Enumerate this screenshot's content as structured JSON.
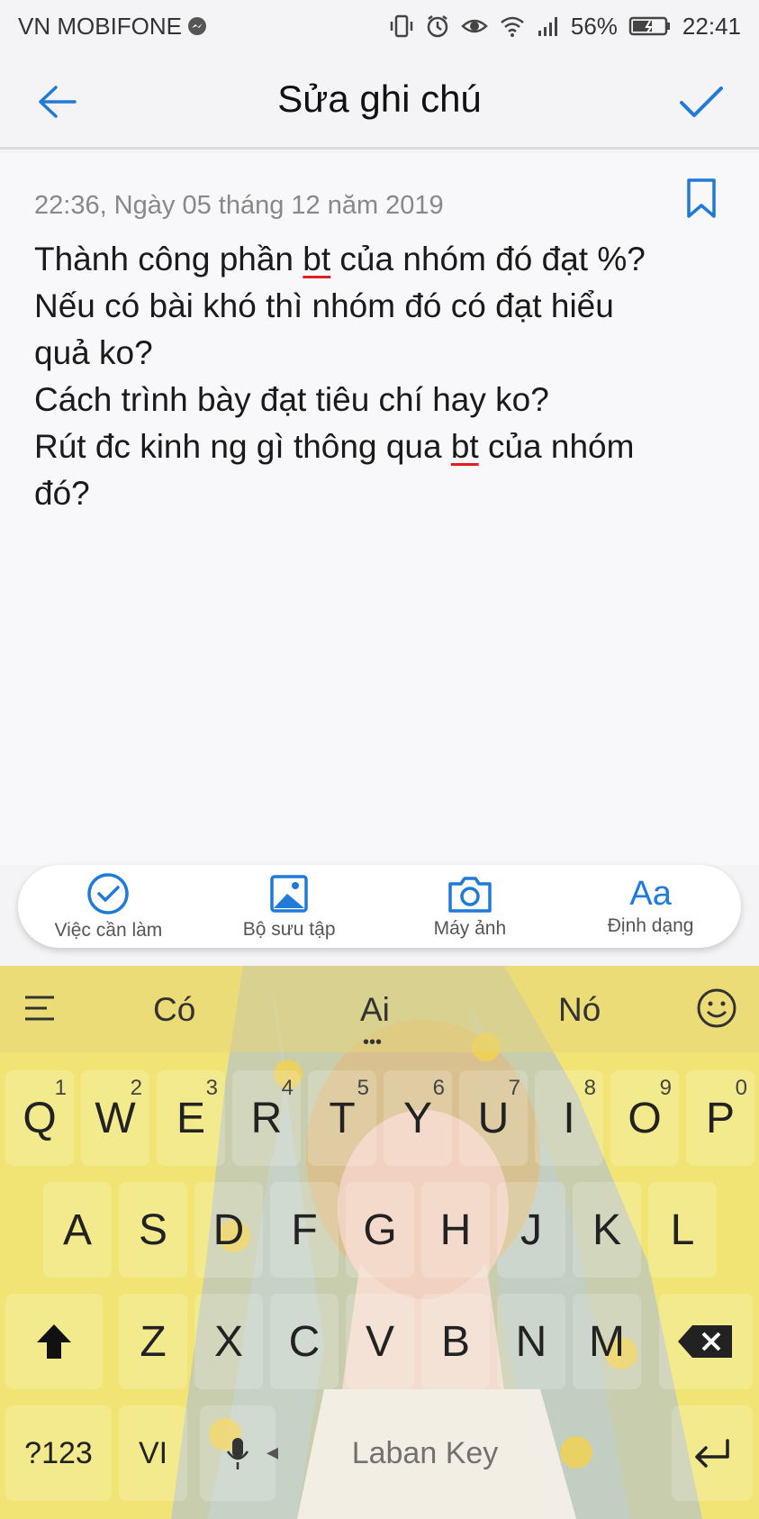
{
  "status_bar": {
    "carrier": "VN MOBIFONE",
    "battery": "56%",
    "time": "22:41",
    "icons": [
      "messenger-icon",
      "vibrate-icon",
      "alarm-icon",
      "eye-icon",
      "wifi-icon",
      "signal-icon",
      "battery-icon"
    ]
  },
  "header": {
    "title": "Sửa ghi chú",
    "accent": "#1f7ad8"
  },
  "note": {
    "timestamp": "22:36, Ngày 05 tháng 12 năm 2019",
    "lines": [
      {
        "pre": "Thành công phần ",
        "mark": "bt",
        "post": " của nhóm đó đạt %?"
      },
      {
        "pre": "Nếu có bài khó thì nhóm đó có đạt hiểu",
        "mark": "",
        "post": ""
      },
      {
        "pre": "quả ko?",
        "mark": "",
        "post": ""
      },
      {
        "pre": "Cách trình bày đạt tiêu chí hay ko?",
        "mark": "",
        "post": ""
      },
      {
        "pre": "Rút đc kinh ng gì thông qua ",
        "mark": "bt",
        "post": " của nhóm"
      },
      {
        "pre": "đó?",
        "mark": "",
        "post": ""
      }
    ]
  },
  "toolbar": {
    "items": [
      {
        "label": "Việc cần làm",
        "icon": "checkmark-circle-icon"
      },
      {
        "label": "Bộ sưu tập",
        "icon": "gallery-icon"
      },
      {
        "label": "Máy ảnh",
        "icon": "camera-icon"
      },
      {
        "label": "Định dạng",
        "icon": "text-format-icon",
        "glyph": "Aa"
      }
    ]
  },
  "keyboard": {
    "suggestions": [
      "Có",
      "Ai",
      "Nó"
    ],
    "row1": [
      {
        "k": "Q",
        "h": "1"
      },
      {
        "k": "W",
        "h": "2"
      },
      {
        "k": "E",
        "h": "3"
      },
      {
        "k": "R",
        "h": "4"
      },
      {
        "k": "T",
        "h": "5"
      },
      {
        "k": "Y",
        "h": "6"
      },
      {
        "k": "U",
        "h": "7"
      },
      {
        "k": "I",
        "h": "8"
      },
      {
        "k": "O",
        "h": "9"
      },
      {
        "k": "P",
        "h": "0"
      }
    ],
    "row2": [
      "A",
      "S",
      "D",
      "F",
      "G",
      "H",
      "J",
      "K",
      "L"
    ],
    "row3": [
      "Z",
      "X",
      "C",
      "V",
      "B",
      "N",
      "M"
    ],
    "numbers_key": "?123",
    "language_key": "VI",
    "space_label": "Laban Key"
  }
}
